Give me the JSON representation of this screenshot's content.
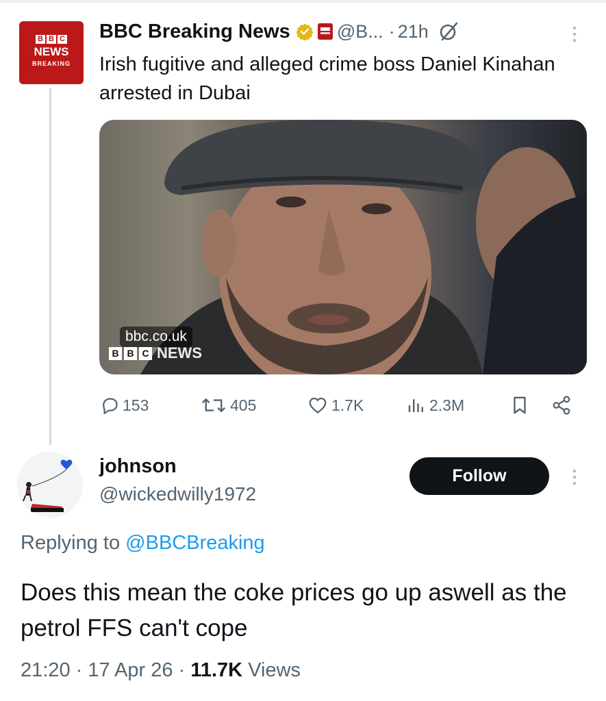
{
  "tweet": {
    "avatar": {
      "letters": [
        "B",
        "B",
        "C"
      ],
      "line1": "NEWS",
      "line2": "BREAKING"
    },
    "author_name": "BBC Breaking News",
    "handle": "@B...",
    "dot": "·",
    "time": "21h",
    "text": "Irish fugitive and alleged crime boss Daniel Kinahan arrested in Dubai",
    "media": {
      "link_tag": "bbc.co.uk",
      "watermark_letters": [
        "B",
        "B",
        "C"
      ],
      "watermark_text": "NEWS"
    },
    "stats": {
      "replies": "153",
      "reposts": "405",
      "likes": "1.7K",
      "views": "2.3M"
    }
  },
  "reply": {
    "name": "johnson",
    "handle": "@wickedwilly1972",
    "follow_label": "Follow",
    "replying_prefix": "Replying to",
    "replying_handle": "@BBCBreaking",
    "text": "Does this mean the coke prices go up aswell as the petrol FFS can't cope",
    "time": "21:20",
    "date": "17 Apr 26",
    "views_count": "11.7K",
    "views_label": "Views",
    "sep": "·"
  },
  "colors": {
    "bbc_red": "#bb1919",
    "link_blue": "#1d9bf0",
    "muted": "#536471",
    "verified_gold": "#e2b719"
  }
}
